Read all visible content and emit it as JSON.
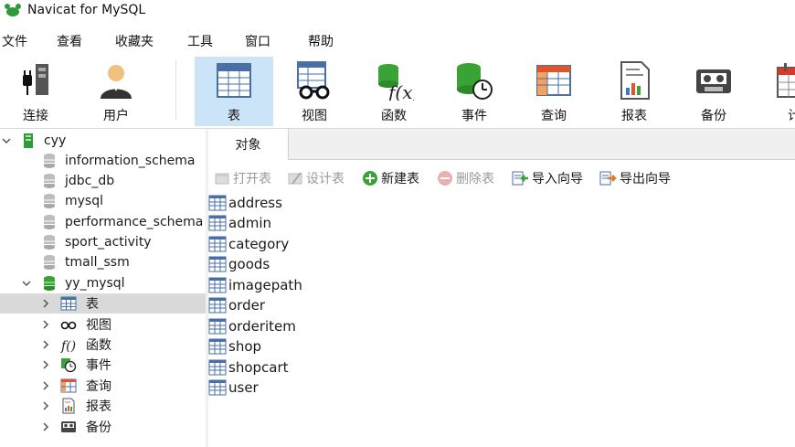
{
  "window": {
    "title": "Navicat for MySQL",
    "logo_icon": "navicat-logo-icon"
  },
  "menu": [
    "文件",
    "查看",
    "收藏夹",
    "工具",
    "窗口",
    "帮助"
  ],
  "toolbar": {
    "active": "表",
    "buttons": [
      {
        "label": "连接",
        "icon": "connection-plug-icon"
      },
      {
        "label": "用户",
        "icon": "user-icon"
      },
      {
        "label": "表",
        "icon": "table-icon"
      },
      {
        "label": "视图",
        "icon": "view-glasses-icon"
      },
      {
        "label": "函数",
        "icon": "function-icon"
      },
      {
        "label": "事件",
        "icon": "event-clock-icon"
      },
      {
        "label": "查询",
        "icon": "query-icon"
      },
      {
        "label": "报表",
        "icon": "report-icon"
      },
      {
        "label": "备份",
        "icon": "backup-tape-icon"
      },
      {
        "label": "计",
        "icon": "schedule-calendar-icon"
      }
    ]
  },
  "tree": {
    "connection": "cyy",
    "databases": [
      "information_schema",
      "jdbc_db",
      "mysql",
      "performance_schema",
      "sport_activity",
      "tmall_ssm",
      "yy_mysql"
    ],
    "open_database": "yy_mysql",
    "children": [
      "表",
      "视图",
      "函数",
      "事件",
      "查询",
      "报表",
      "备份"
    ],
    "selected_child": "表"
  },
  "tabs": [
    "对象"
  ],
  "object_toolbar": [
    {
      "label": "打开表",
      "enabled": false
    },
    {
      "label": "设计表",
      "enabled": false
    },
    {
      "label": "新建表",
      "enabled": true
    },
    {
      "label": "删除表",
      "enabled": false
    },
    {
      "label": "导入向导",
      "enabled": true
    },
    {
      "label": "导出向导",
      "enabled": true
    }
  ],
  "tables": [
    "address",
    "admin",
    "category",
    "goods",
    "imagepath",
    "order",
    "orderitem",
    "shop",
    "shopcart",
    "user"
  ],
  "colors": {
    "accent_selected": "#cce4f7",
    "tree_selected": "#d9d9d9",
    "db_open_green": "#3aa335",
    "db_closed_gray": "#b5b5b5"
  }
}
